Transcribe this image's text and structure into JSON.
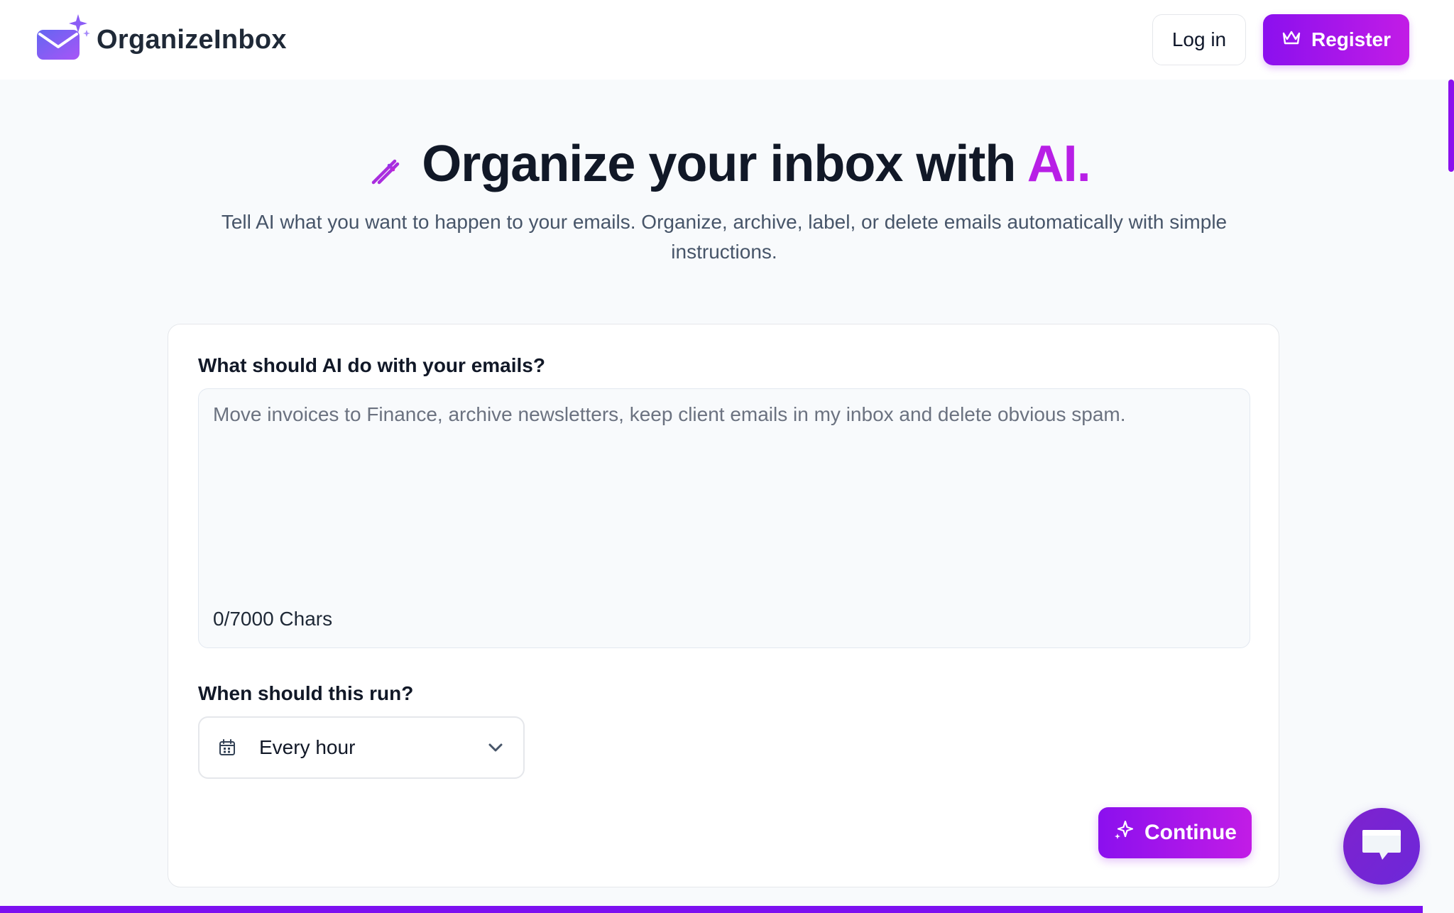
{
  "header": {
    "logo_text": "OrganizeInbox",
    "login_label": "Log in",
    "register_label": "Register"
  },
  "hero": {
    "title_main": "Organize your inbox with ",
    "title_accent": "AI.",
    "subtitle": "Tell AI what you want to happen to your emails. Organize, archive, label, or delete emails automatically with simple instructions."
  },
  "form": {
    "instructions_label": "What should AI do with your emails?",
    "instructions_placeholder": "Move invoices to Finance, archive newsletters, keep client emails in my inbox and delete obvious spam.",
    "instructions_value": "",
    "char_count": "0/7000 Chars",
    "schedule_label": "When should this run?",
    "schedule_value": "Every hour",
    "continue_label": "Continue"
  },
  "colors": {
    "accent": "#b81fe6",
    "gradient_start": "#8b10ee",
    "gradient_end": "#c21ce6",
    "chat": "#7e22ce"
  },
  "icons": {
    "logo": "envelope-sparkle-icon",
    "register": "crown-icon",
    "hero": "magic-wand-icon",
    "schedule": "calendar-icon",
    "dropdown": "chevron-down-icon",
    "continue": "sparkles-icon",
    "chat": "chat-bubble-icon"
  }
}
